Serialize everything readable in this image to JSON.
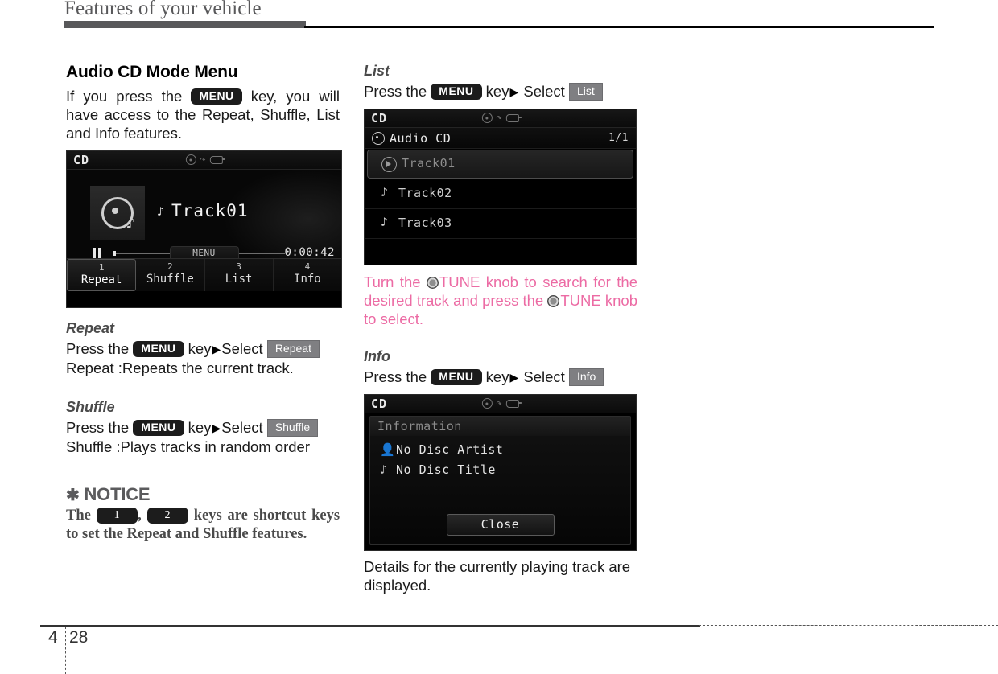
{
  "header": {
    "title": "Features of your vehicle"
  },
  "left_column": {
    "section_title": "Audio CD Mode Menu",
    "intro_prefix": "If you press the",
    "intro_key": "MENU",
    "intro_suffix": "key, you will have access to the Repeat, Shuffle, List and Info features.",
    "player_screen": {
      "source_label": "CD",
      "status_icons": [
        "disc-icon",
        "usb-icon",
        "aux-icon"
      ],
      "track_title": "Track01",
      "note_glyph": "♪",
      "elapsed_time": "0:00:42",
      "playback_state": "paused",
      "menu_tab_label": "MENU",
      "softkeys": [
        {
          "number": "1",
          "label": "Repeat",
          "active": true
        },
        {
          "number": "2",
          "label": "Shuffle",
          "active": false
        },
        {
          "number": "3",
          "label": "List",
          "active": false
        },
        {
          "number": "4",
          "label": "Info",
          "active": false
        }
      ]
    },
    "repeat": {
      "title": "Repeat",
      "press_text": "Press the",
      "key": "MENU",
      "key_word": "key",
      "arrow": "▶",
      "select_word": "Select",
      "option": "Repeat",
      "description": "Repeat :Repeats the current track."
    },
    "shuffle": {
      "title": "Shuffle",
      "press_text": "Press the",
      "key": "MENU",
      "key_word": "key",
      "arrow": "▶",
      "select_word": "Select",
      "option": "Shuffle",
      "description": "Shuffle :Plays tracks in random order"
    },
    "notice": {
      "star": "✱",
      "heading": "NOTICE",
      "text_start": "The",
      "key1": "1",
      "separator": ",",
      "key2": "2",
      "text_end": "keys are shortcut keys to set the Repeat and Shuffle features."
    }
  },
  "right_column": {
    "list": {
      "title": "List",
      "press_text": "Press the",
      "key": "MENU",
      "key_word": "key",
      "arrow": "▶",
      "select_word": "Select",
      "option": "List"
    },
    "list_screen": {
      "source_label": "CD",
      "status_icons": [
        "disc-icon",
        "usb-icon",
        "aux-icon"
      ],
      "header_label": "Audio CD",
      "page_indicator": "1/1",
      "rows": [
        {
          "label": "Track01",
          "selected": true,
          "icon": "play-icon"
        },
        {
          "label": "Track02",
          "selected": false,
          "icon": "note-icon"
        },
        {
          "label": "Track03",
          "selected": false,
          "icon": "note-icon"
        }
      ],
      "note_glyph": "♪"
    },
    "tune_note": {
      "part1": "Turn the",
      "part2": "TUNE knob to search for the desired track and press the",
      "part3": "TUNE knob to select.",
      "color": "#ec6ba4",
      "icon": "tune-knob-icon"
    },
    "info": {
      "title": "Info",
      "press_text": "Press the",
      "key": "MENU",
      "key_word": "key",
      "arrow": "▶",
      "select_word": "Select",
      "option": "Info"
    },
    "info_screen": {
      "source_label": "CD",
      "status_icons": [
        "disc-icon",
        "usb-icon",
        "aux-icon"
      ],
      "panel_title": "Information",
      "rows": [
        {
          "icon": "person-icon",
          "glyph": "👤",
          "label": "No Disc Artist"
        },
        {
          "icon": "note-icon",
          "glyph": "♪",
          "label": "No Disc Title"
        }
      ],
      "close_button": "Close"
    },
    "info_caption": "Details for the currently playing track are displayed."
  },
  "footer": {
    "chapter": "4",
    "page": "28"
  }
}
